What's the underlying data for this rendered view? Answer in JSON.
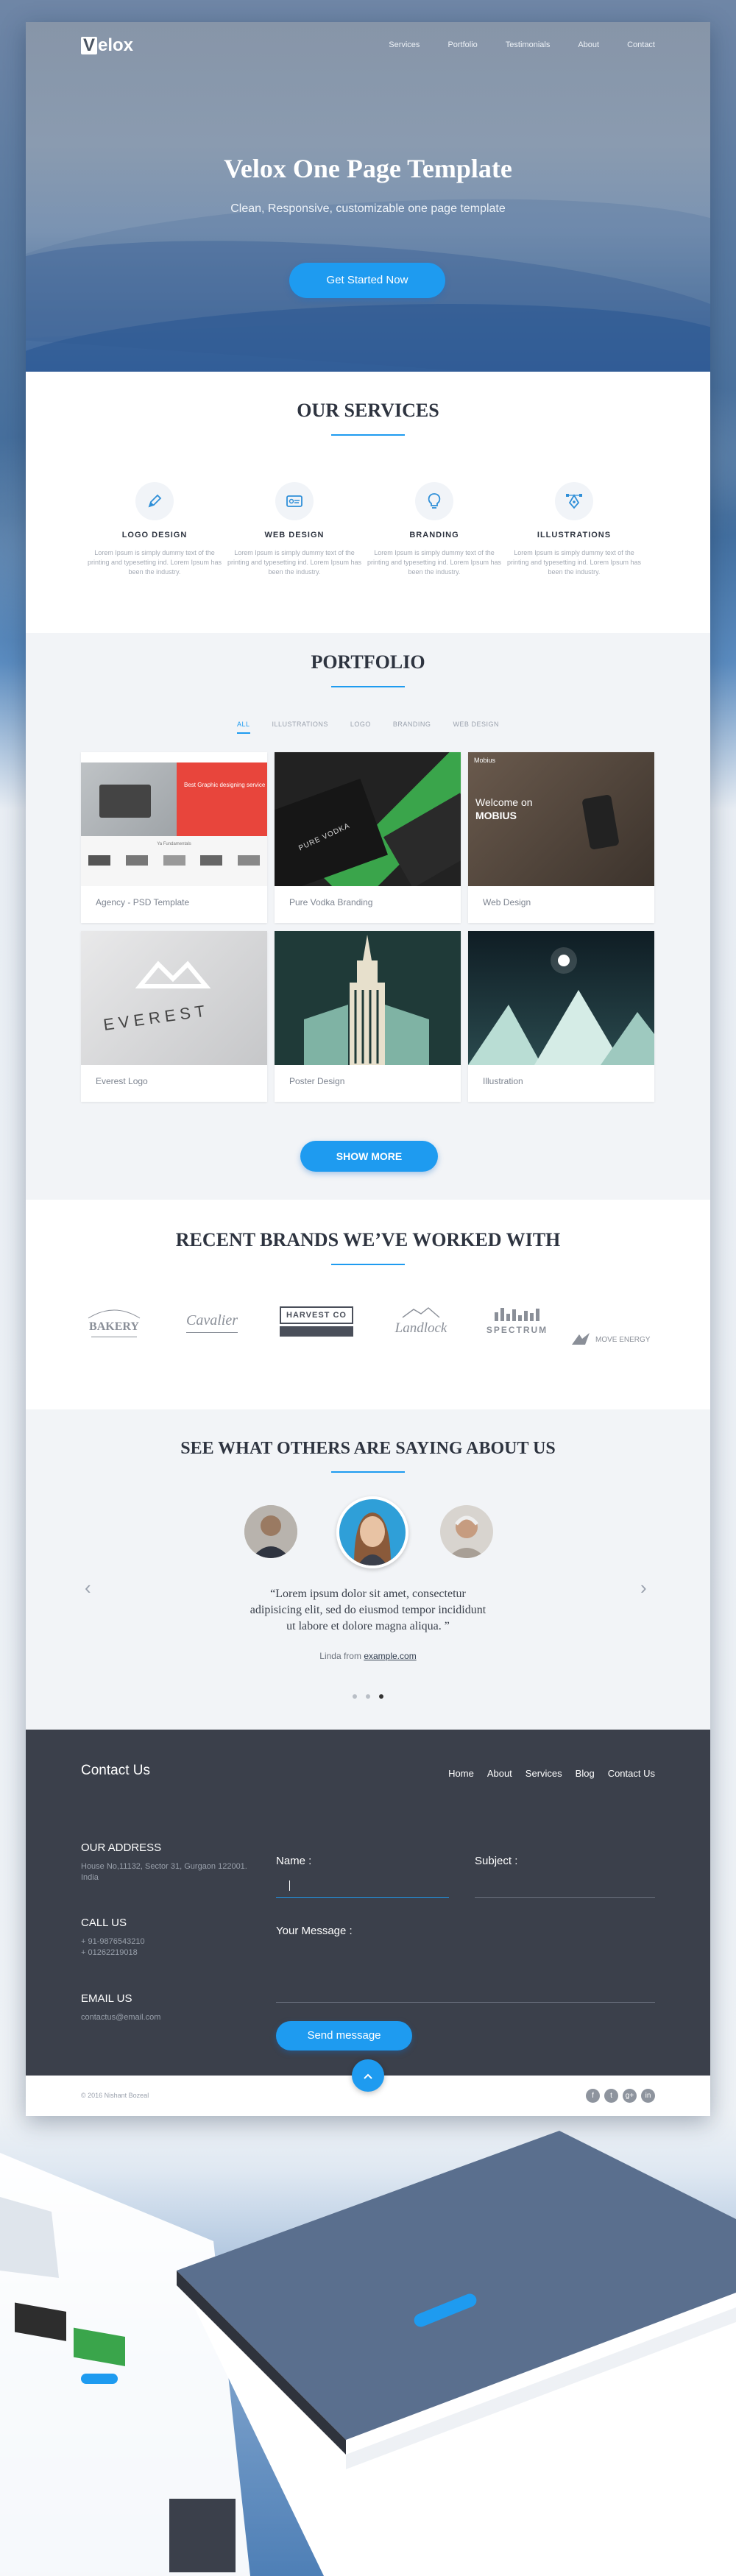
{
  "brand": {
    "logo_letter": "V",
    "logo_rest": "elox"
  },
  "nav": [
    "Services",
    "Portfolio",
    "Testimonials",
    "About",
    "Contact"
  ],
  "hero": {
    "title": "Velox One Page Template",
    "subtitle": "Clean, Responsive, customizable one page template",
    "cta": "Get Started Now"
  },
  "services": {
    "title": "OUR SERVICES",
    "items": [
      {
        "icon": "pencil-icon",
        "title": "LOGO DESIGN",
        "text": "Lorem Ipsum is simply dummy text of the printing and typesetting ind. Lorem Ipsum has been the industry."
      },
      {
        "icon": "web-design-icon",
        "title": "WEB DESIGN",
        "text": "Lorem Ipsum is simply dummy text of the printing and typesetting ind. Lorem Ipsum has been the industry."
      },
      {
        "icon": "lightbulb-icon",
        "title": "BRANDING",
        "text": "Lorem Ipsum is simply dummy text of the printing and typesetting ind. Lorem Ipsum has been the industry."
      },
      {
        "icon": "vector-pen-icon",
        "title": "ILLUSTRATIONS",
        "text": "Lorem Ipsum is simply dummy text of the printing and typesetting ind. Lorem Ipsum has been the industry."
      }
    ]
  },
  "portfolio": {
    "title": "PORTFOLIO",
    "filters": [
      "ALL",
      "ILLUSTRATIONS",
      "LOGO",
      "BRANDING",
      "WEB DESIGN"
    ],
    "active_filter": "ALL",
    "items": [
      {
        "caption": "Agency - PSD Template"
      },
      {
        "caption": "Pure Vodka Branding",
        "thumb_text": "PURE VODKA"
      },
      {
        "caption": "Web Design",
        "thumb_text": "Welcome on",
        "thumb_text2": "MOBIUS",
        "thumb_brand": "Mobius"
      },
      {
        "caption": "Everest Logo",
        "thumb_text": "EVEREST"
      },
      {
        "caption": "Poster Design"
      },
      {
        "caption": "Illustration"
      }
    ],
    "agency_thumb": {
      "headline": "Best Graphic designing service",
      "sub": "Ya Fundamentals"
    },
    "show_more": "SHOW MORE"
  },
  "brands": {
    "title": "RECENT BRANDS WE’VE WORKED WITH",
    "logos": [
      "BAKERY",
      "Cavalier",
      "HARVEST CO",
      "Landlock",
      "SPECTRUM",
      "MOVE ENERGY"
    ]
  },
  "testimonials": {
    "title": "SEE WHAT OTHERS ARE SAYING ABOUT US",
    "quote": "“Lorem ipsum dolor sit amet, consectetur adipisicing elit, sed do eiusmod tempor incididunt ut labore et dolore magna aliqua. ”",
    "author": "Linda from",
    "author_link": "example.com",
    "prev": "‹",
    "next": "›"
  },
  "contact": {
    "title": "Contact Us",
    "nav": [
      "Home",
      "About",
      "Services",
      "Blog",
      "Contact Us"
    ],
    "address_label": "OUR ADDRESS",
    "address": "House No,11132, Sector 31, Gurgaon 122001. India",
    "call_label": "CALL US",
    "phones": [
      "+ 91-9876543210",
      "+ 01262219018"
    ],
    "email_label": "EMAIL US",
    "email": "contactus@email.com",
    "name_label": "Name :",
    "subject_label": "Subject :",
    "message_label": "Your Message :",
    "send": "Send message"
  },
  "footer": {
    "copyright": "© 2016 Nishant Bozeal",
    "social": [
      "f",
      "t",
      "g+",
      "in"
    ]
  },
  "colors": {
    "accent": "#1e9bf0",
    "dark": "#3b404b",
    "muted": "#9aa1ad"
  }
}
